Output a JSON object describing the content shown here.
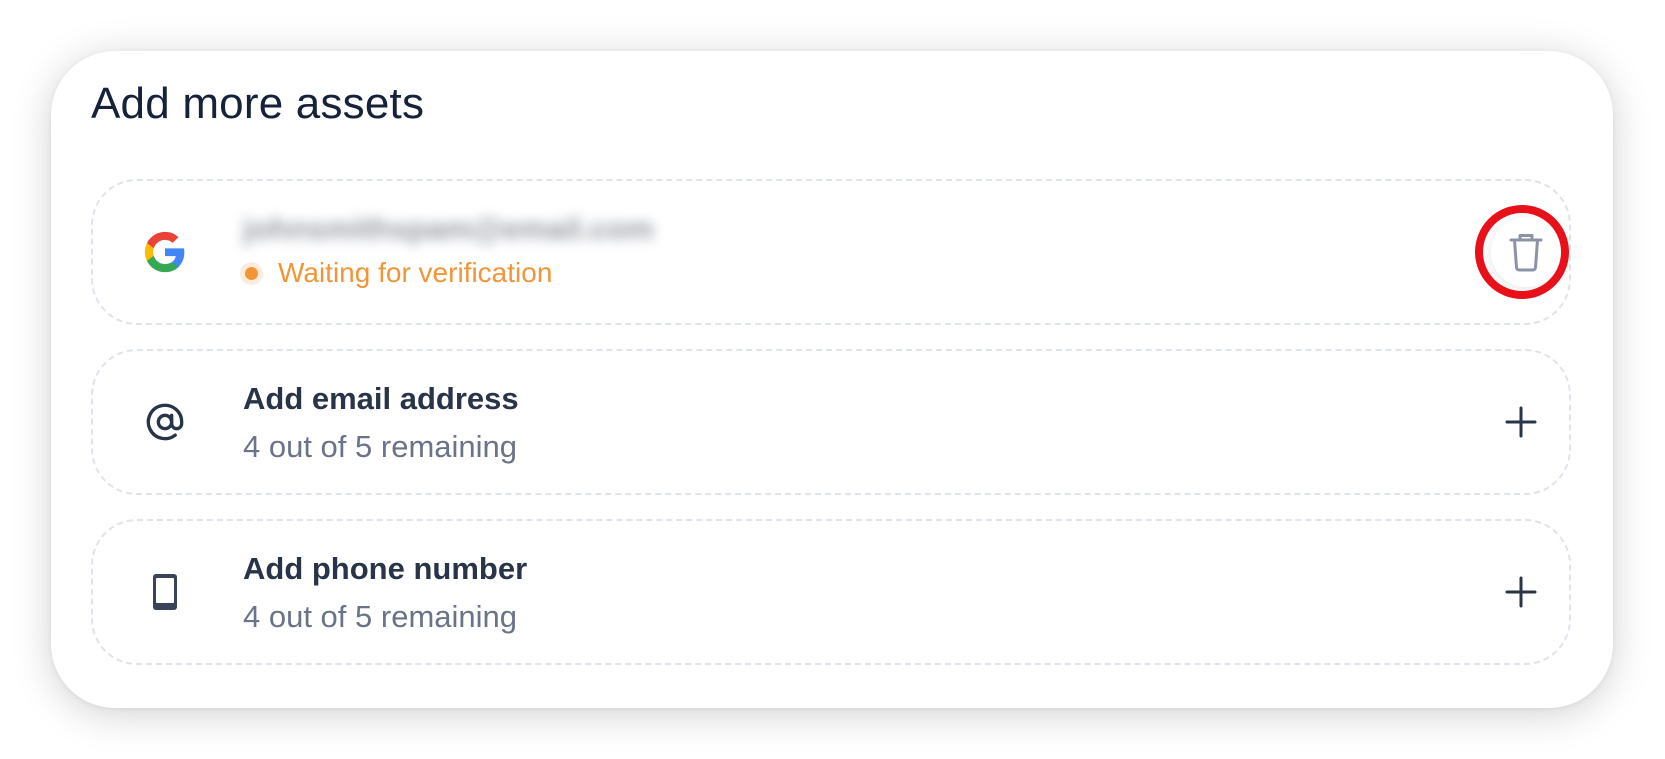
{
  "section": {
    "title": "Add more assets"
  },
  "assets": {
    "google": {
      "icon": "google-logo-icon",
      "email": "johnsmithspam@email.com",
      "status": "Waiting for verification",
      "status_color": "#f29537",
      "action_icon": "trash-icon"
    },
    "email": {
      "icon": "at-sign-icon",
      "title": "Add email address",
      "subtitle": "4 out of 5 remaining",
      "action_icon": "plus-icon"
    },
    "phone": {
      "icon": "mobile-phone-icon",
      "title": "Add phone number",
      "subtitle": "4 out of 5 remaining",
      "action_icon": "plus-icon"
    }
  },
  "annotation": {
    "highlight_color": "#e8111a",
    "highlight_target": "trash-icon"
  }
}
